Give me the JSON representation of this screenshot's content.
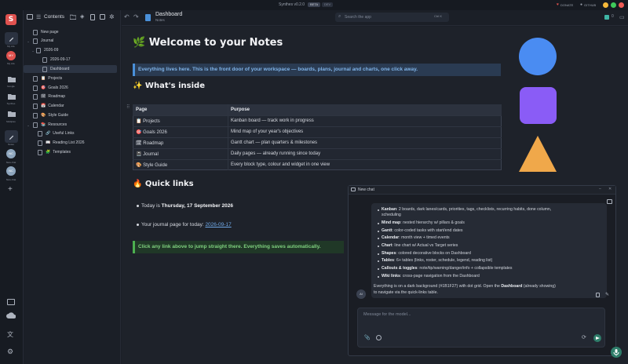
{
  "window": {
    "app_title": "Synthes v0.2.0",
    "beta_badge": "BETA",
    "dev_badge": "DEV",
    "donate_label": "DONATE",
    "github_label": "GITHUB"
  },
  "rail": {
    "logo_letter": "S",
    "items": [
      {
        "label": "My Life"
      },
      {
        "label": "My Life"
      },
      {
        "label": "Google"
      },
      {
        "label": "Synthes"
      },
      {
        "label": "Multiplex"
      },
      {
        "label": "Notes"
      },
      {
        "label": "New chat"
      },
      {
        "label": "New chat"
      }
    ],
    "avatar_initials": "MY",
    "chat_initials_1": "NC",
    "chat_initials_2": "NC"
  },
  "sidebar": {
    "title": "Contents",
    "items": [
      {
        "label": "New page",
        "indent": 1
      },
      {
        "label": "Journal",
        "indent": 1,
        "expanded": true
      },
      {
        "label": "2026-09",
        "indent": 2,
        "expanded": true
      },
      {
        "label": "2026-09-17",
        "indent": 3
      },
      {
        "label": "Dashboard",
        "indent": 1,
        "selected": true
      },
      {
        "label": "Projects",
        "indent": 1,
        "emoji": "📋"
      },
      {
        "label": "Goals 2026",
        "indent": 1,
        "emoji": "🎯"
      },
      {
        "label": "Roadmap",
        "indent": 1,
        "emoji": "🗓"
      },
      {
        "label": "Calendar",
        "indent": 1,
        "emoji": "📅"
      },
      {
        "label": "Style Guide",
        "indent": 1,
        "emoji": "🎨"
      },
      {
        "label": "Resources",
        "indent": 1,
        "emoji": "📚",
        "expanded": true
      },
      {
        "label": "Useful Links",
        "indent": 2,
        "emoji": "🔗"
      },
      {
        "label": "Reading List 2026",
        "indent": 2,
        "emoji": "📖"
      },
      {
        "label": "Templates",
        "indent": 2,
        "emoji": "🧩"
      }
    ]
  },
  "header": {
    "title": "Dashboard",
    "subtitle": "Notes",
    "search_placeholder": "Search the app",
    "search_shortcut": "Ctrl K",
    "sync_count": "0"
  },
  "page": {
    "title": "🌿 Welcome to your Notes",
    "intro_callout": "Everything lives here. This is the front door of your workspace — boards, plans, journal and charts, one click away.",
    "inside_heading": "✨ What's inside",
    "table": {
      "headers": [
        "Page",
        "Purpose"
      ],
      "rows": [
        {
          "page": "📋 Projects",
          "purpose": "Kanban board — track work in progress"
        },
        {
          "page": "🎯 Goals 2026",
          "purpose": "Mind map of your year's objectives"
        },
        {
          "page": "🗓 Roadmap",
          "purpose": "Gantt chart — plan quarters & milestones"
        },
        {
          "page": "📓 Journal",
          "purpose": "Daily pages — already running since today"
        },
        {
          "page": "🎨 Style Guide",
          "purpose": "Every block type, colour and widget in one view"
        }
      ]
    },
    "quick_links_heading": "🔥 Quick links",
    "today_prefix": "Today is ",
    "today_date": "Thursday, 17 September 2026",
    "journal_prefix": "Your journal page for today: ",
    "journal_link": "2026-09-17",
    "bottom_callout": "Click any link above to jump straight there. Everything saves automatically.",
    "colors": {
      "circle": "#4a8cf2",
      "square": "#8a5cf6",
      "triangle": "#f0a84a"
    }
  },
  "chat": {
    "title": "New chat",
    "items": [
      {
        "bold": "Kanban",
        "text": ": 2 boards, dark lanes/cards, priorities, tags, checklists, recurring habits, done column,"
      },
      {
        "bold": "",
        "text": "scheduling"
      },
      {
        "bold": "Mind map",
        "text": ": nested hierarchy w/ pillars & goals"
      },
      {
        "bold": "Gantt",
        "text": ": color-coded tasks with start/end dates"
      },
      {
        "bold": "Calendar",
        "text": ": month view + timed events"
      },
      {
        "bold": "Chart",
        "text": ": line chart w/ Actual vs Target series"
      },
      {
        "bold": "Shapes",
        "text": ": colored decorative blocks on Dashboard"
      },
      {
        "bold": "Tables",
        "text": ": 6+ tables (links, roster, schedule, legend, reading list)"
      },
      {
        "bold": "Callouts & toggles",
        "text": ": note/tip/warning/danger/info + collapsible templates"
      },
      {
        "bold": "Wiki links",
        "text": ": cross-page navigation from the Dashboard"
      }
    ],
    "summary_line1_prefix": "Everything is on a dark background (#1B1F27) with dot grid. Open the ",
    "summary_line1_bold": "Dashboard",
    "summary_line1_suffix": " (already showing)",
    "summary_line2": "to navigate via the quick-links table.",
    "ai_initials": "AI",
    "input_placeholder": "Message for the model..."
  }
}
